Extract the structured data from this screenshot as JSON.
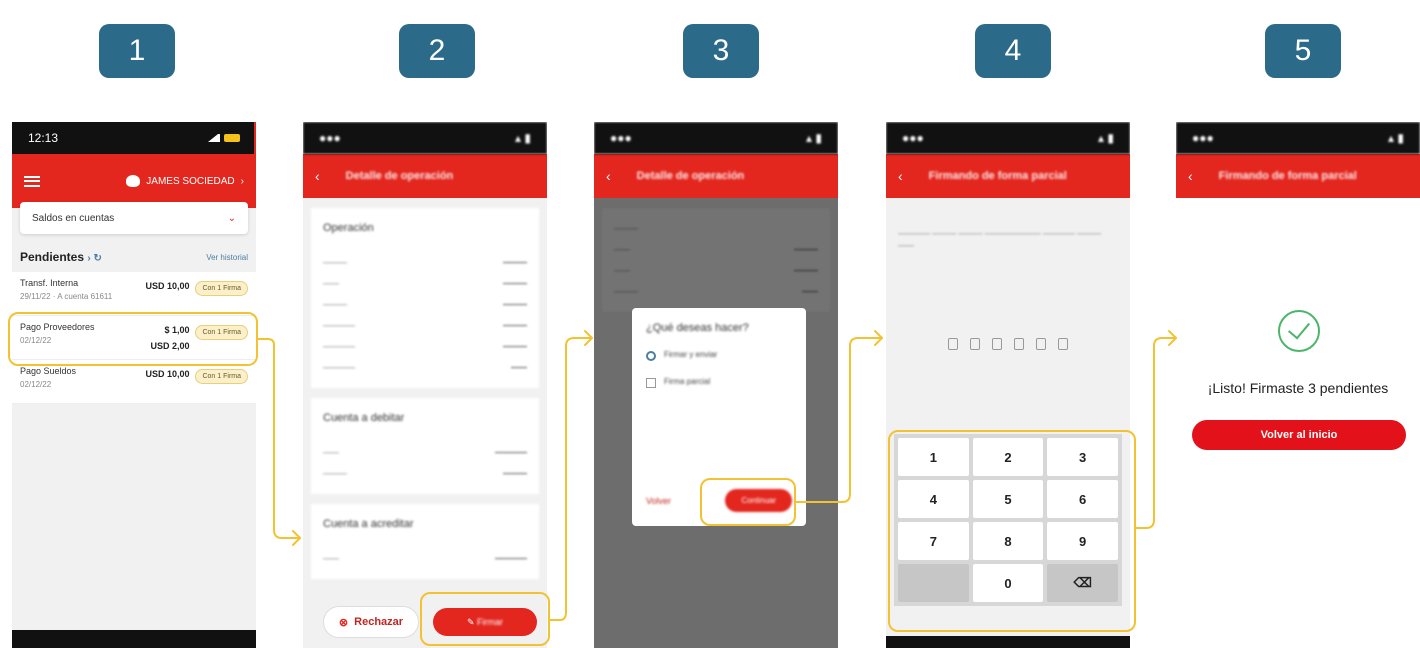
{
  "steps": [
    "1",
    "2",
    "3",
    "4",
    "5"
  ],
  "screen1": {
    "time": "12:13",
    "company": "JAMES SOCIEDAD",
    "select_value": "Saldos en cuentas",
    "pending_title": "Pendientes",
    "history_link": "Ver historial",
    "rows": [
      {
        "title": "Transf. Interna",
        "sub": "29/11/22 · A cuenta 61611",
        "amount1": "USD 10,00",
        "amount2": "",
        "badge": "Con 1 Firma"
      },
      {
        "title": "Pago Proveedores",
        "sub": "02/12/22",
        "amount1": "$ 1,00",
        "amount2": "USD 2,00",
        "badge": "Con 1 Firma"
      },
      {
        "title": "Pago Sueldos",
        "sub": "02/12/22",
        "amount1": "USD 10,00",
        "amount2": "",
        "badge": "Con 1 Firma"
      }
    ]
  },
  "screen2": {
    "title": "Detalle de operación",
    "section1": "Operación",
    "section2": "Cuenta a debitar",
    "section3": "Cuenta a acreditar",
    "reject_label": "Rechazar",
    "sign_label": "Firmar"
  },
  "screen3": {
    "title": "Detalle de operación",
    "question": "¿Qué deseas hacer?",
    "option1": "Firmar y enviar",
    "option2": "Firma parcial",
    "cancel_label": "Volver",
    "continue_label": "Continuar"
  },
  "screen4": {
    "title": "Firmando de forma parcial",
    "keys": [
      "1",
      "2",
      "3",
      "4",
      "5",
      "6",
      "7",
      "8",
      "9",
      "",
      "0",
      "⌫"
    ]
  },
  "screen5": {
    "title": "Firmando de forma parcial",
    "message": "¡Listo! Firmaste 3 pendientes",
    "home_button": "Volver al inicio"
  },
  "colors": {
    "badge": "#2b6a89",
    "brand_red": "#e3261e",
    "highlight": "#f3c232",
    "success": "#4db56a"
  }
}
